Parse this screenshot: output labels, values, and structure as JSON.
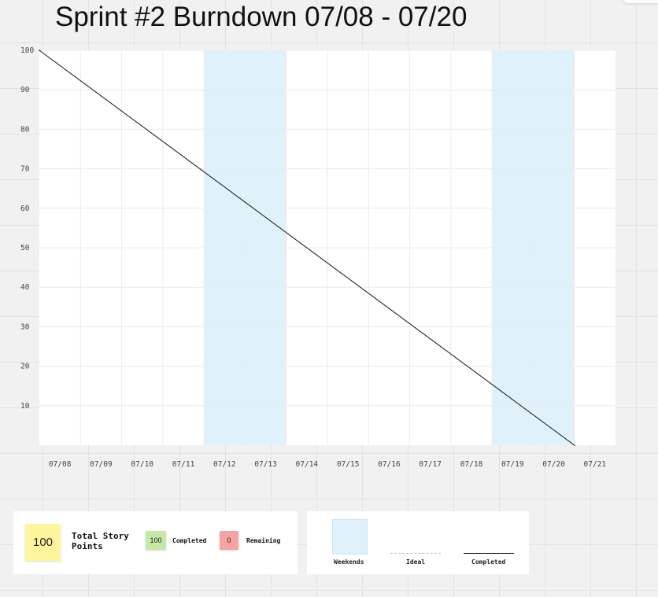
{
  "title": "Sprint #2 Burndown 07/08 - 07/20",
  "chart_data": {
    "type": "line",
    "title": "Sprint #2 Burndown 07/08 - 07/20",
    "xlabel": "",
    "ylabel": "",
    "x_categories": [
      "07/08",
      "07/09",
      "07/10",
      "07/11",
      "07/12",
      "07/13",
      "07/14",
      "07/15",
      "07/16",
      "07/17",
      "07/18",
      "07/19",
      "07/20",
      "07/21"
    ],
    "ylim": [
      0,
      100
    ],
    "y_ticks": [
      100,
      90,
      80,
      70,
      60,
      50,
      40,
      30,
      20,
      10
    ],
    "weekend_bands": [
      [
        "07/12",
        "07/13"
      ],
      [
        "07/19",
        "07/20"
      ]
    ],
    "series": [
      {
        "name": "Ideal",
        "x": [
          "07/08",
          "07/21"
        ],
        "y": [
          100,
          0
        ],
        "color": "#111111"
      }
    ],
    "grid": true,
    "colors": {
      "weekend": "#dff1fb",
      "plot_bg": "#ffffff",
      "gridline": "#ececec",
      "line": "#111111"
    }
  },
  "summary": {
    "total_value": "100",
    "total_label": "Total Story Points",
    "completed_value": "100",
    "completed_label": "Completed",
    "remaining_value": "0",
    "remaining_label": "Remaining"
  },
  "legend": {
    "weekends": "Weekends",
    "ideal": "Ideal",
    "completed": "Completed"
  }
}
